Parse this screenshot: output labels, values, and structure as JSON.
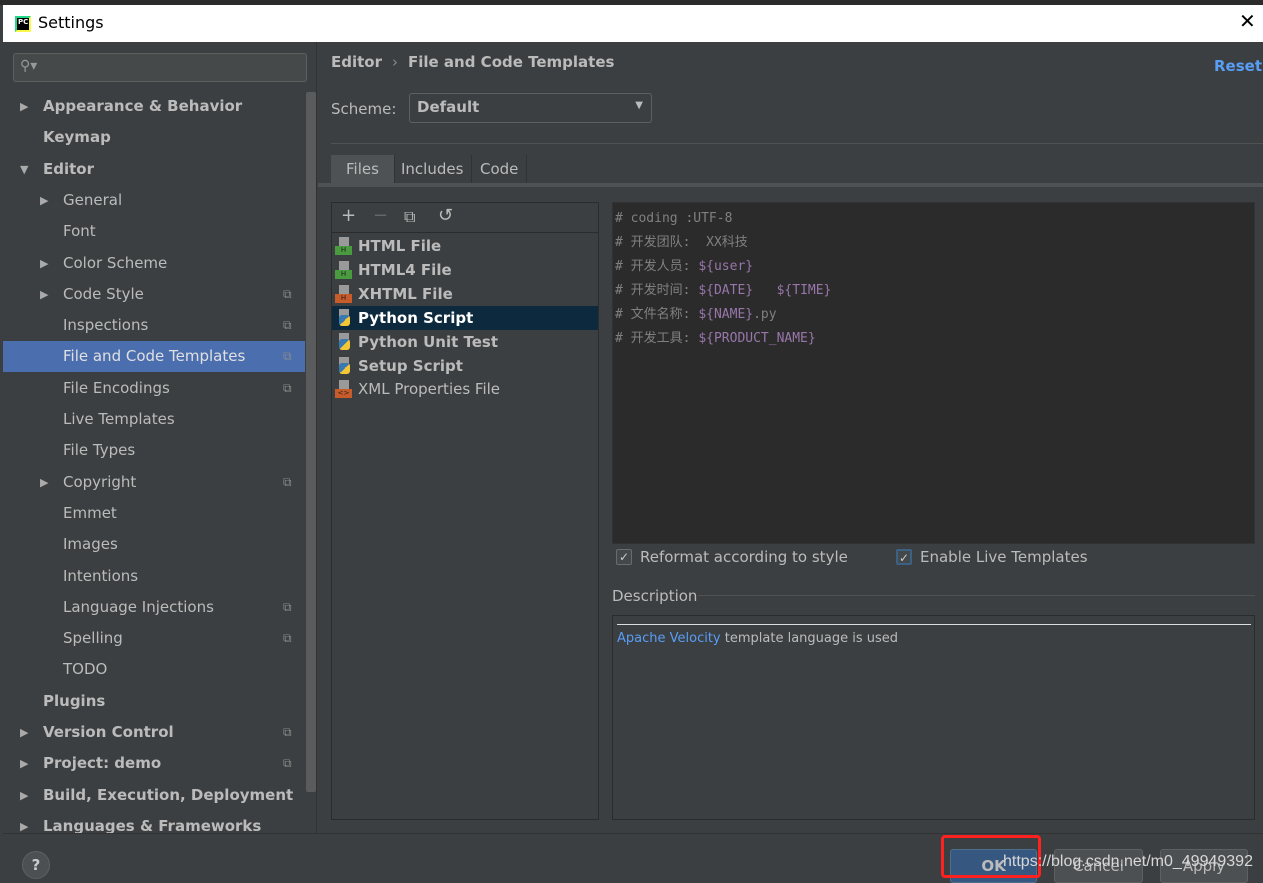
{
  "window": {
    "title": "Settings",
    "app_icon": "PC",
    "close": "✕"
  },
  "sidebar": {
    "search_icon": "⚲▾",
    "items": [
      {
        "label": "Appearance & Behavior",
        "level": 0,
        "arrow": "right",
        "bold": true,
        "copy": false
      },
      {
        "label": "Keymap",
        "level": 0,
        "arrow": "none",
        "bold": true,
        "copy": false
      },
      {
        "label": "Editor",
        "level": 0,
        "arrow": "down",
        "bold": true,
        "copy": false
      },
      {
        "label": "General",
        "level": 1,
        "arrow": "right",
        "bold": false,
        "copy": false
      },
      {
        "label": "Font",
        "level": 1,
        "arrow": "none",
        "bold": false,
        "copy": false
      },
      {
        "label": "Color Scheme",
        "level": 1,
        "arrow": "right",
        "bold": false,
        "copy": false
      },
      {
        "label": "Code Style",
        "level": 1,
        "arrow": "right",
        "bold": false,
        "copy": true
      },
      {
        "label": "Inspections",
        "level": 1,
        "arrow": "none",
        "bold": false,
        "copy": true
      },
      {
        "label": "File and Code Templates",
        "level": 1,
        "arrow": "none",
        "bold": false,
        "copy": true,
        "selected": true
      },
      {
        "label": "File Encodings",
        "level": 1,
        "arrow": "none",
        "bold": false,
        "copy": true
      },
      {
        "label": "Live Templates",
        "level": 1,
        "arrow": "none",
        "bold": false,
        "copy": false
      },
      {
        "label": "File Types",
        "level": 1,
        "arrow": "none",
        "bold": false,
        "copy": false
      },
      {
        "label": "Copyright",
        "level": 1,
        "arrow": "right",
        "bold": false,
        "copy": true
      },
      {
        "label": "Emmet",
        "level": 1,
        "arrow": "none",
        "bold": false,
        "copy": false
      },
      {
        "label": "Images",
        "level": 1,
        "arrow": "none",
        "bold": false,
        "copy": false
      },
      {
        "label": "Intentions",
        "level": 1,
        "arrow": "none",
        "bold": false,
        "copy": false
      },
      {
        "label": "Language Injections",
        "level": 1,
        "arrow": "none",
        "bold": false,
        "copy": true
      },
      {
        "label": "Spelling",
        "level": 1,
        "arrow": "none",
        "bold": false,
        "copy": true
      },
      {
        "label": "TODO",
        "level": 1,
        "arrow": "none",
        "bold": false,
        "copy": false
      },
      {
        "label": "Plugins",
        "level": 0,
        "arrow": "none",
        "bold": true,
        "copy": false
      },
      {
        "label": "Version Control",
        "level": 0,
        "arrow": "right",
        "bold": true,
        "copy": true
      },
      {
        "label": "Project: demo",
        "level": 0,
        "arrow": "right",
        "bold": true,
        "copy": true
      },
      {
        "label": "Build, Execution, Deployment",
        "level": 0,
        "arrow": "right",
        "bold": true,
        "copy": false
      },
      {
        "label": "Languages & Frameworks",
        "level": 0,
        "arrow": "right",
        "bold": true,
        "copy": false
      }
    ]
  },
  "main": {
    "breadcrumb": [
      "Editor",
      "File and Code Templates"
    ],
    "breadcrumb_sep": "›",
    "reset": "Reset",
    "scheme_label": "Scheme:",
    "scheme_value": "Default",
    "tabs": [
      {
        "label": "Files",
        "active": true
      },
      {
        "label": "Includes"
      },
      {
        "label": "Code"
      }
    ],
    "toolbar": {
      "add": "+",
      "remove": "−",
      "copy": "⧉",
      "reset": "↺"
    },
    "templates": [
      {
        "label": "HTML File",
        "icon": "html",
        "color": "#4a9a3f",
        "bold": true
      },
      {
        "label": "HTML4 File",
        "icon": "html",
        "color": "#4a9a3f",
        "bold": true
      },
      {
        "label": "XHTML File",
        "icon": "html",
        "color": "#c75b2a",
        "bold": true
      },
      {
        "label": "Python Script",
        "icon": "python",
        "bold": true,
        "selected": true
      },
      {
        "label": "Python Unit Test",
        "icon": "python",
        "bold": true
      },
      {
        "label": "Setup Script",
        "icon": "python",
        "bold": true
      },
      {
        "label": "XML Properties File",
        "icon": "xml",
        "color": "#c75b2a",
        "bold": false
      }
    ],
    "code_lines": [
      [
        {
          "t": "# coding :UTF-8"
        }
      ],
      [
        {
          "t": "# 开发团队:  XX科技"
        }
      ],
      [
        {
          "t": "# 开发人员: "
        },
        {
          "t": "${user}",
          "v": true
        }
      ],
      [
        {
          "t": "# 开发时间: "
        },
        {
          "t": "${DATE}",
          "v": true
        },
        {
          "t": "   "
        },
        {
          "t": "${TIME}",
          "v": true
        }
      ],
      [
        {
          "t": "# 文件名称: "
        },
        {
          "t": "${NAME}",
          "v": true
        },
        {
          "t": ".py"
        }
      ],
      [
        {
          "t": "# 开发工具: "
        },
        {
          "t": "${PRODUCT_NAME}",
          "v": true
        }
      ]
    ],
    "reformat": {
      "label": "Reformat according to style",
      "checked": true
    },
    "live_templates": {
      "label": "Enable Live Templates",
      "checked": true
    },
    "description_label": "Description",
    "description_link": "Apache Velocity",
    "description_text": " template language is used"
  },
  "footer": {
    "help": "?",
    "ok": "OK",
    "cancel": "Cancel",
    "apply": "Apply",
    "watermark": "https://blog.csdn.net/m0_49949392"
  },
  "colors": {
    "accent": "#4b6eaf",
    "link": "#589df6",
    "annotation": "#ff2020"
  }
}
